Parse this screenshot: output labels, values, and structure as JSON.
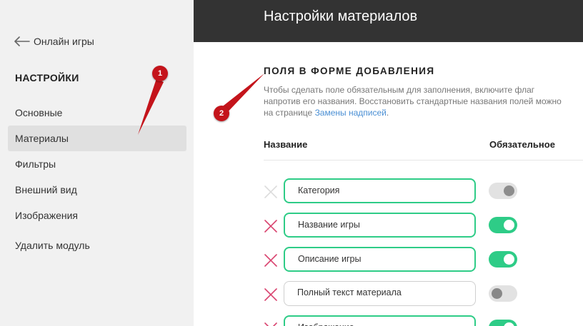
{
  "sidebar": {
    "back_label": "Онлайн игры",
    "heading": "НАСТРОЙКИ",
    "items": [
      {
        "label": "Основные"
      },
      {
        "label": "Материалы",
        "active": true
      },
      {
        "label": "Фильтры"
      },
      {
        "label": "Внешний вид"
      },
      {
        "label": "Изображения"
      }
    ],
    "delete_label": "Удалить модуль"
  },
  "header": {
    "title": "Настройки материалов"
  },
  "section": {
    "title": "ПОЛЯ В ФОРМЕ ДОБАВЛЕНИЯ",
    "desc_text": "Чтобы сделать поле обязательным для заполнения, включите флаг напротив его названия. Восстановить стандартные названия полей можно на странице ",
    "desc_link": "Замены надписей",
    "desc_end": "."
  },
  "table": {
    "col_name": "Название",
    "col_required": "Обязательное",
    "rows": [
      {
        "value": "Категория",
        "required": "disabled"
      },
      {
        "value": "Название игры",
        "required": "on"
      },
      {
        "value": "Описание игры",
        "required": "on"
      },
      {
        "value": "Полный текст материала",
        "required": "off"
      },
      {
        "value": "Изображение",
        "required": "on"
      }
    ]
  },
  "annotations": {
    "marker1": "1",
    "marker2": "2"
  },
  "colors": {
    "accent_green": "#2ecc87",
    "remove_x": "#d9436f",
    "header_bg": "#333333",
    "marker_red": "#c4141b"
  }
}
